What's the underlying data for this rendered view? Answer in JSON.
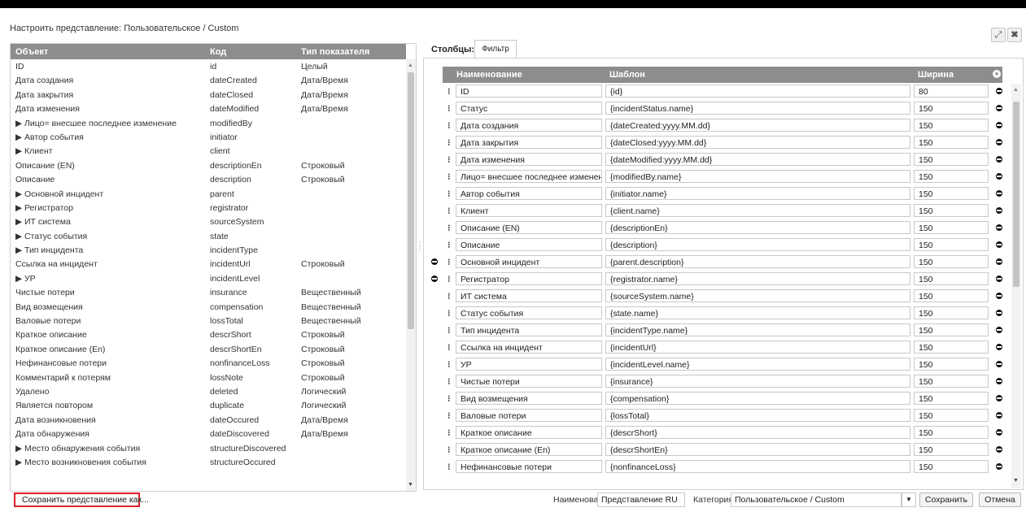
{
  "window": {
    "title": "Настроить представление: Пользовательское / Custom",
    "maximize_icon": "⤢",
    "close_icon": "✖"
  },
  "left_table": {
    "headers": {
      "object": "Объект",
      "code": "Код",
      "type": "Тип показателя"
    },
    "rows": [
      {
        "object": "ID",
        "code": "id",
        "type": "Целый"
      },
      {
        "object": "Дата создания",
        "code": "dateCreated",
        "type": "Дата/Время"
      },
      {
        "object": "Дата закрытия",
        "code": "dateClosed",
        "type": "Дата/Время"
      },
      {
        "object": "Дата изменения",
        "code": "dateModified",
        "type": "Дата/Время"
      },
      {
        "object": "▶ Лицо= внесшее последнее изменение",
        "code": "modifiedBy",
        "type": ""
      },
      {
        "object": "▶ Автор события",
        "code": "initiator",
        "type": ""
      },
      {
        "object": "▶ Клиент",
        "code": "client",
        "type": ""
      },
      {
        "object": "Описание (EN)",
        "code": "descriptionEn",
        "type": "Строковый"
      },
      {
        "object": "Описание",
        "code": "description",
        "type": "Строковый"
      },
      {
        "object": "▶ Основной инцидент",
        "code": "parent",
        "type": ""
      },
      {
        "object": "▶ Регистратор",
        "code": "registrator",
        "type": ""
      },
      {
        "object": "▶ ИТ система",
        "code": "sourceSystem",
        "type": ""
      },
      {
        "object": "▶ Статус события",
        "code": "state",
        "type": ""
      },
      {
        "object": "▶ Тип инцидента",
        "code": "incidentType",
        "type": ""
      },
      {
        "object": "Ссылка на инцидент",
        "code": "incidentUrl",
        "type": "Строковый"
      },
      {
        "object": "▶ УР",
        "code": "incidentLevel",
        "type": ""
      },
      {
        "object": "Чистые потери",
        "code": "insurance",
        "type": "Вещественный"
      },
      {
        "object": "Вид возмещения",
        "code": "compensation",
        "type": "Вещественный"
      },
      {
        "object": "Валовые потери",
        "code": "lossTotal",
        "type": "Вещественный"
      },
      {
        "object": "Краткое описание",
        "code": "descrShort",
        "type": "Строковый"
      },
      {
        "object": "Краткое описание (En)",
        "code": "descrShortEn",
        "type": "Строковый"
      },
      {
        "object": "Нефинансовые потери",
        "code": "nonfinanceLoss",
        "type": "Строковый"
      },
      {
        "object": "Комментарий к потерям",
        "code": "lossNote",
        "type": "Строковый"
      },
      {
        "object": "Удалено",
        "code": "deleted",
        "type": "Логический"
      },
      {
        "object": "Является повтором",
        "code": "duplicate",
        "type": "Логический"
      },
      {
        "object": "Дата возникновения",
        "code": "dateOccured",
        "type": "Дата/Время"
      },
      {
        "object": "Дата обнаружения",
        "code": "dateDiscovered",
        "type": "Дата/Время"
      },
      {
        "object": "▶ Место обнаружения события",
        "code": "structureDiscovered",
        "type": ""
      },
      {
        "object": "▶ Место возникновения события",
        "code": "structureOccured",
        "type": ""
      }
    ]
  },
  "tabs": {
    "columns": "Столбцы:",
    "filter": "Фильтр"
  },
  "right_table": {
    "headers": {
      "name": "Наименование",
      "template": "Шаблон",
      "width": "Ширина"
    },
    "rows": [
      {
        "name": "ID",
        "template": "{id}",
        "width": "80"
      },
      {
        "name": "Статус",
        "template": "{incidentStatus.name}",
        "width": "150"
      },
      {
        "name": "Дата создания",
        "template": "{dateCreated:yyyy.MM.dd}",
        "width": "150"
      },
      {
        "name": "Дата закрытия",
        "template": "{dateClosed:yyyy.MM.dd}",
        "width": "150"
      },
      {
        "name": "Дата изменения",
        "template": "{dateModified:yyyy.MM.dd}",
        "width": "150"
      },
      {
        "name": "Лицо= внесшее последнее изменение",
        "template": "{modifiedBy.name}",
        "width": "150"
      },
      {
        "name": "Автор события",
        "template": "{initiator.name}",
        "width": "150"
      },
      {
        "name": "Клиент",
        "template": "{client.name}",
        "width": "150"
      },
      {
        "name": "Описание (EN)",
        "template": "{descriptionEn}",
        "width": "150"
      },
      {
        "name": "Описание",
        "template": "{description}",
        "width": "150"
      },
      {
        "name": "Основной инцидент",
        "template": "{parent.description}",
        "width": "150"
      },
      {
        "name": "Регистратор",
        "template": "{registrator.name}",
        "width": "150"
      },
      {
        "name": "ИТ система",
        "template": "{sourceSystem.name}",
        "width": "150"
      },
      {
        "name": "Статус события",
        "template": "{state.name}",
        "width": "150"
      },
      {
        "name": "Тип инцидента",
        "template": "{incidentType.name}",
        "width": "150"
      },
      {
        "name": "Ссылка на инцидент",
        "template": "{incidentUrl}",
        "width": "150"
      },
      {
        "name": "УР",
        "template": "{incidentLevel.name}",
        "width": "150"
      },
      {
        "name": "Чистые потери",
        "template": "{insurance}",
        "width": "150"
      },
      {
        "name": "Вид возмещения",
        "template": "{compensation}",
        "width": "150"
      },
      {
        "name": "Валовые потери",
        "template": "{lossTotal}",
        "width": "150"
      },
      {
        "name": "Краткое описание",
        "template": "{descrShort}",
        "width": "150"
      },
      {
        "name": "Краткое описание (En)",
        "template": "{descrShortEn}",
        "width": "150"
      },
      {
        "name": "Нефинансовые потери",
        "template": "{nonfinanceLoss}",
        "width": "150"
      }
    ]
  },
  "footer": {
    "save_as": "Сохранить представление как...",
    "name_label": "Наименование",
    "name_value": "Представление RU",
    "category_label": "Категория",
    "category_value": "Пользовательское / Custom",
    "save": "Сохранить",
    "cancel": "Отмена"
  }
}
